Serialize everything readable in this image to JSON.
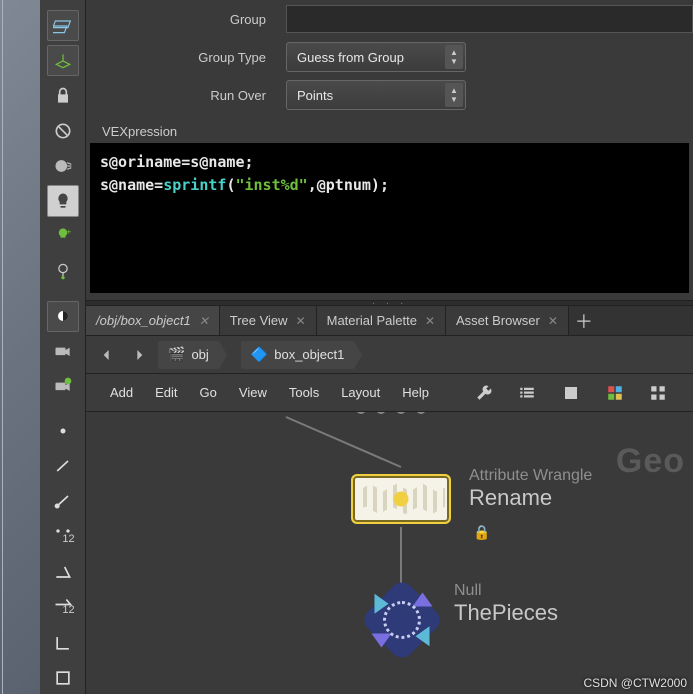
{
  "params": {
    "group_label": "Group",
    "group_value": "",
    "group_type_label": "Group Type",
    "group_type_value": "Guess from Group",
    "run_over_label": "Run Over",
    "run_over_value": "Points",
    "vex_label": "VEXpression",
    "code": {
      "line1a": "s@oriname=s@name;",
      "line2a": "s@name=",
      "line2b": "sprintf",
      "line2c": "(",
      "line2d": "\"inst%d\"",
      "line2e": ",@ptnum);"
    }
  },
  "tabs": [
    {
      "label": "/obj/box_object1",
      "active": true
    },
    {
      "label": "Tree View",
      "active": false
    },
    {
      "label": "Material Palette",
      "active": false
    },
    {
      "label": "Asset Browser",
      "active": false
    }
  ],
  "breadcrumb": {
    "level1": "obj",
    "level2": "box_object1"
  },
  "menu": {
    "add": "Add",
    "edit": "Edit",
    "go": "Go",
    "view": "View",
    "tools": "Tools",
    "layout": "Layout",
    "help": "Help"
  },
  "canvas": {
    "big_label": "Geo",
    "node1_type": "Attribute Wrangle",
    "node1_name": "Rename",
    "node2_type": "Null",
    "node2_name": "ThePieces"
  },
  "toolbar_number": "12",
  "watermark": "CSDN @CTW2000"
}
